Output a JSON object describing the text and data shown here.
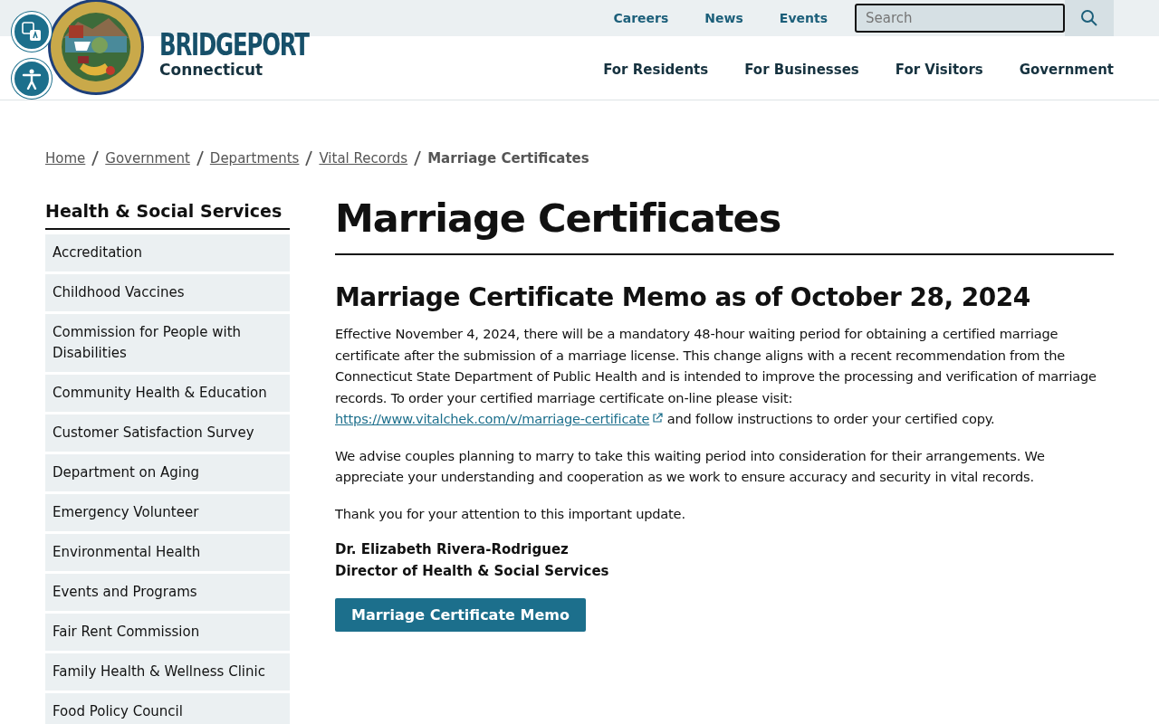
{
  "utility_nav": {
    "links": [
      "Careers",
      "News",
      "Events"
    ],
    "search": {
      "placeholder": "Search"
    }
  },
  "brand": {
    "name": "BRIDGEPORT",
    "subtitle": "Connecticut"
  },
  "main_nav": [
    "For Residents",
    "For Businesses",
    "For Visitors",
    "Government"
  ],
  "breadcrumbs": [
    {
      "label": "Home",
      "link": true
    },
    {
      "label": "Government",
      "link": true
    },
    {
      "label": "Departments",
      "link": true
    },
    {
      "label": "Vital Records",
      "link": true
    },
    {
      "label": "Marriage Certificates",
      "link": false
    }
  ],
  "sidebar": {
    "title": "Health & Social Services",
    "items": [
      "Accreditation",
      "Childhood Vaccines",
      "Commission for People with Disabilities",
      "Community Health & Education",
      "Customer Satisfaction Survey",
      "Department on Aging",
      "Emergency Volunteer",
      "Environmental Health",
      "Events and Programs",
      "Fair Rent Commission",
      "Family Health & Wellness Clinic",
      "Food Policy Council"
    ]
  },
  "page_title": "Marriage Certificates",
  "memo": {
    "heading": "Marriage Certificate Memo as of October 28, 2024",
    "intro": {
      "before": "Effective November 4, 2024, there will be a mandatory 48-hour waiting period for obtaining a certified marriage certificate after the submission of a marriage license. This change aligns with a recent recommendation from the Connecticut State Department of Public Health and is intended to improve the processing and verification of marriage records. To order your certified marriage certificate on-line please visit:",
      "link": "https://www.vitalchek.com/v/marriage-certificate",
      "after": "and follow instructions to order your certified copy."
    },
    "paragraphs": [
      "We advise couples planning to marry to take this waiting period into consideration for their arrangements. We appreciate your understanding and cooperation as we work to ensure accuracy and security in vital records.",
      "Thank you for your attention to this important update."
    ],
    "signature": [
      "Dr. Elizabeth Rivera-Rodriguez",
      "Director of Health & Social Services"
    ],
    "button": "Marriage Certificate Memo"
  }
}
